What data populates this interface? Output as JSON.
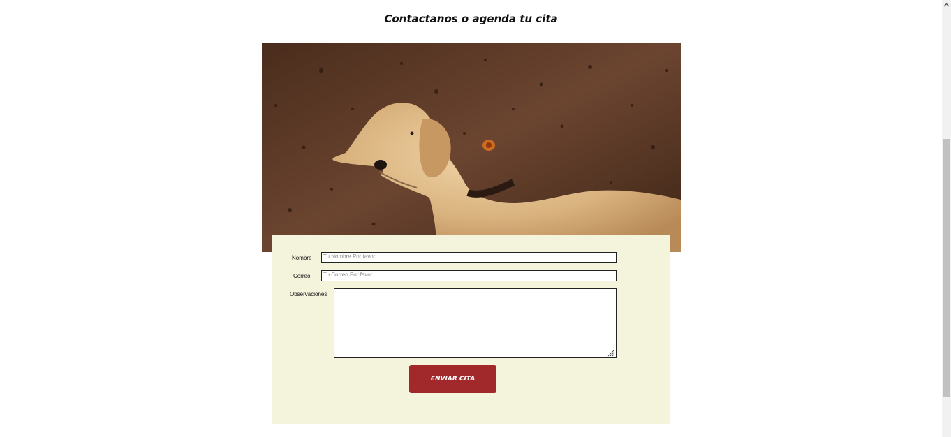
{
  "heading": "Contactanos o agenda tu cita",
  "hero_image": {
    "alt": "dog"
  },
  "form": {
    "name_label": "Nombre",
    "name_placeholder": "Tu Nombre Por favor",
    "email_label": "Correo",
    "email_placeholder": "Tu Correo Por favor",
    "notes_label": "Observaciones",
    "submit_label": "ENVIAR CITA"
  },
  "colors": {
    "panel_bg": "#f4f4dc",
    "button_bg": "#a2292b",
    "wall": "#5a3a24"
  }
}
